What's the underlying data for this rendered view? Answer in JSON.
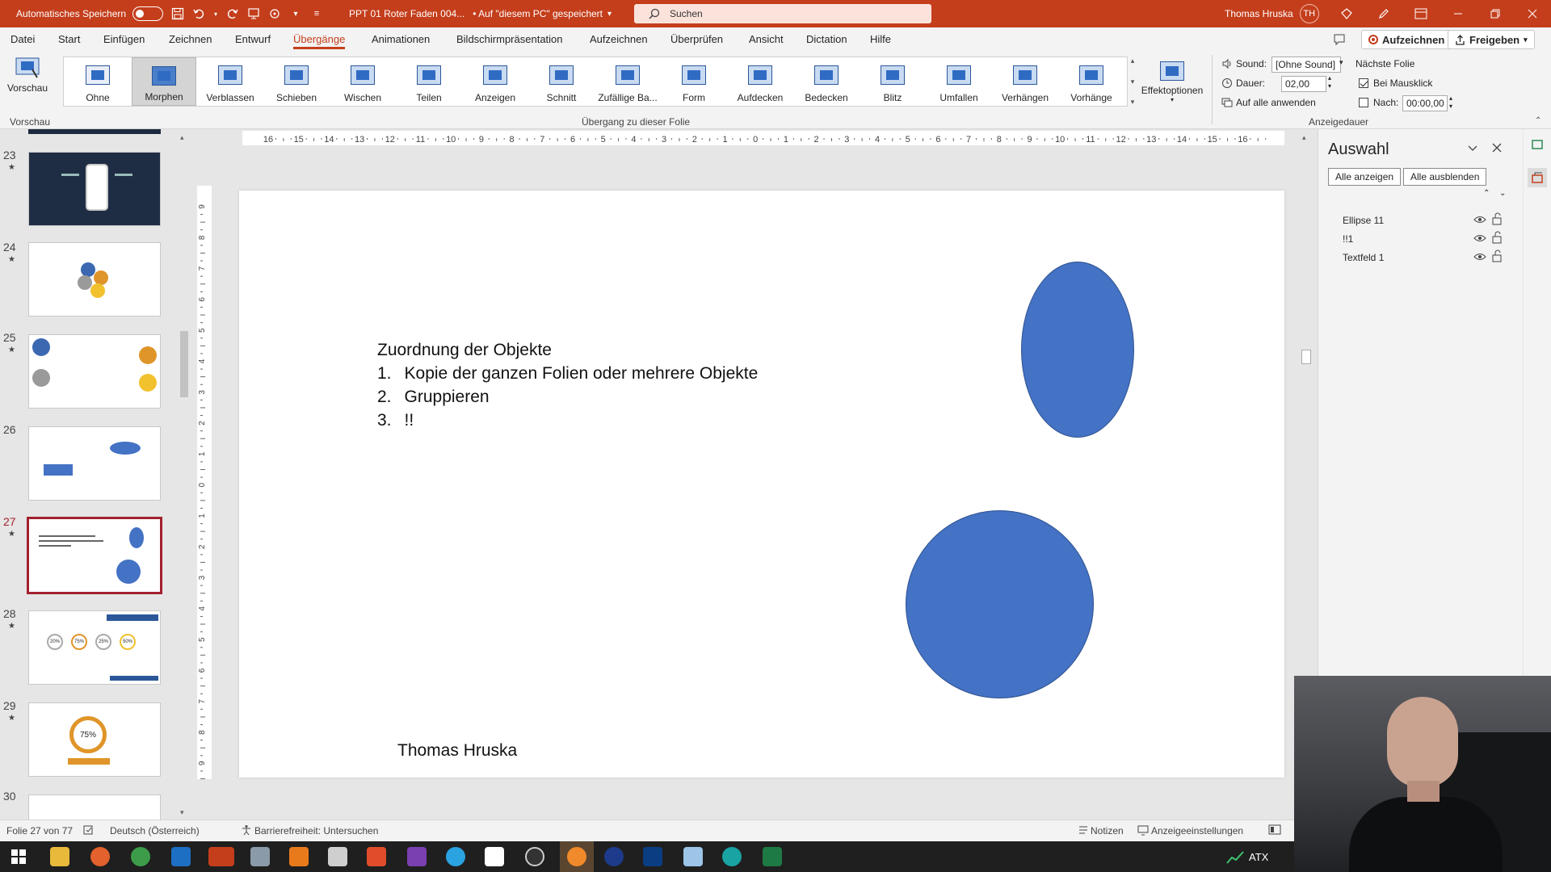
{
  "titlebar": {
    "autosave_label": "Automatisches Speichern",
    "doc_title": "PPT 01 Roter Faden 004...",
    "save_state": "• Auf \"diesem PC\" gespeichert",
    "search_placeholder": "Suchen",
    "user_name": "Thomas Hruska",
    "user_initials": "TH"
  },
  "menu": {
    "items": [
      "Datei",
      "Start",
      "Einfügen",
      "Zeichnen",
      "Entwurf",
      "Übergänge",
      "Animationen",
      "Bildschirmpräsentation",
      "Aufzeichnen",
      "Überprüfen",
      "Ansicht",
      "Dictation",
      "Hilfe"
    ],
    "active": "Übergänge",
    "record_button": "Aufzeichnen",
    "share_button": "Freigeben"
  },
  "ribbon": {
    "preview_label": "Vorschau",
    "preview_group": "Vorschau",
    "transitions": [
      "Ohne",
      "Morphen",
      "Verblassen",
      "Schieben",
      "Wischen",
      "Teilen",
      "Anzeigen",
      "Schnitt",
      "Zufällige Ba...",
      "Form",
      "Aufdecken",
      "Bedecken",
      "Blitz",
      "Umfallen",
      "Verhängen",
      "Vorhänge"
    ],
    "selected_transition": "Morphen",
    "effect_options": "Effektoptionen",
    "group_label": "Übergang zu dieser Folie",
    "sound_label": "Sound:",
    "sound_value": "[Ohne Sound]",
    "duration_label": "Dauer:",
    "duration_value": "02,00",
    "apply_all": "Auf alle anwenden",
    "next_slide": "Nächste Folie",
    "on_click": "Bei Mausklick",
    "after_label": "Nach:",
    "after_value": "00:00,00",
    "timing_group": "Anzeigedauer"
  },
  "thumbnails": {
    "slides": [
      {
        "num": "23",
        "star": "★"
      },
      {
        "num": "24",
        "star": "★"
      },
      {
        "num": "25",
        "star": "★"
      },
      {
        "num": "26",
        "star": ""
      },
      {
        "num": "27",
        "star": "★"
      },
      {
        "num": "28",
        "star": "★"
      },
      {
        "num": "29",
        "star": "★"
      },
      {
        "num": "30",
        "star": ""
      }
    ],
    "selected": "27",
    "t29_percent": "75%",
    "t28_values": [
      "20%",
      "75%",
      "25%",
      "50%"
    ]
  },
  "slide": {
    "heading": "Zuordnung  der Objekte",
    "list": [
      {
        "n": "1.",
        "text": "Kopie der ganzen Folien oder mehrere Objekte"
      },
      {
        "n": "2.",
        "text": "Gruppieren"
      },
      {
        "n": "3.",
        "text": "!!"
      }
    ],
    "footer": "Thomas Hruska",
    "shape_color": "#4472c4"
  },
  "ruler": {
    "h_labels": [
      "16",
      "15",
      "14",
      "13",
      "12",
      "11",
      "10",
      "9",
      "8",
      "7",
      "6",
      "5",
      "4",
      "3",
      "2",
      "1",
      "0",
      "1",
      "2",
      "3",
      "4",
      "5",
      "6",
      "7",
      "8",
      "9",
      "10",
      "11",
      "12",
      "13",
      "14",
      "15",
      "16"
    ],
    "v_labels": [
      "9",
      "8",
      "7",
      "6",
      "5",
      "4",
      "3",
      "2",
      "1",
      "0",
      "1",
      "2",
      "3",
      "4",
      "5",
      "6",
      "7",
      "8",
      "9"
    ]
  },
  "selection_pane": {
    "title": "Auswahl",
    "show_all": "Alle anzeigen",
    "hide_all": "Alle ausblenden",
    "items": [
      "Ellipse 11",
      "!!1",
      "Textfeld 1"
    ]
  },
  "status": {
    "slide_info": "Folie 27 von 77",
    "language": "Deutsch (Österreich)",
    "accessibility": "Barrierefreiheit: Untersuchen",
    "notes": "Notizen",
    "display_settings": "Anzeigeeinstellungen"
  },
  "taskbar": {
    "stock": "ATX"
  }
}
